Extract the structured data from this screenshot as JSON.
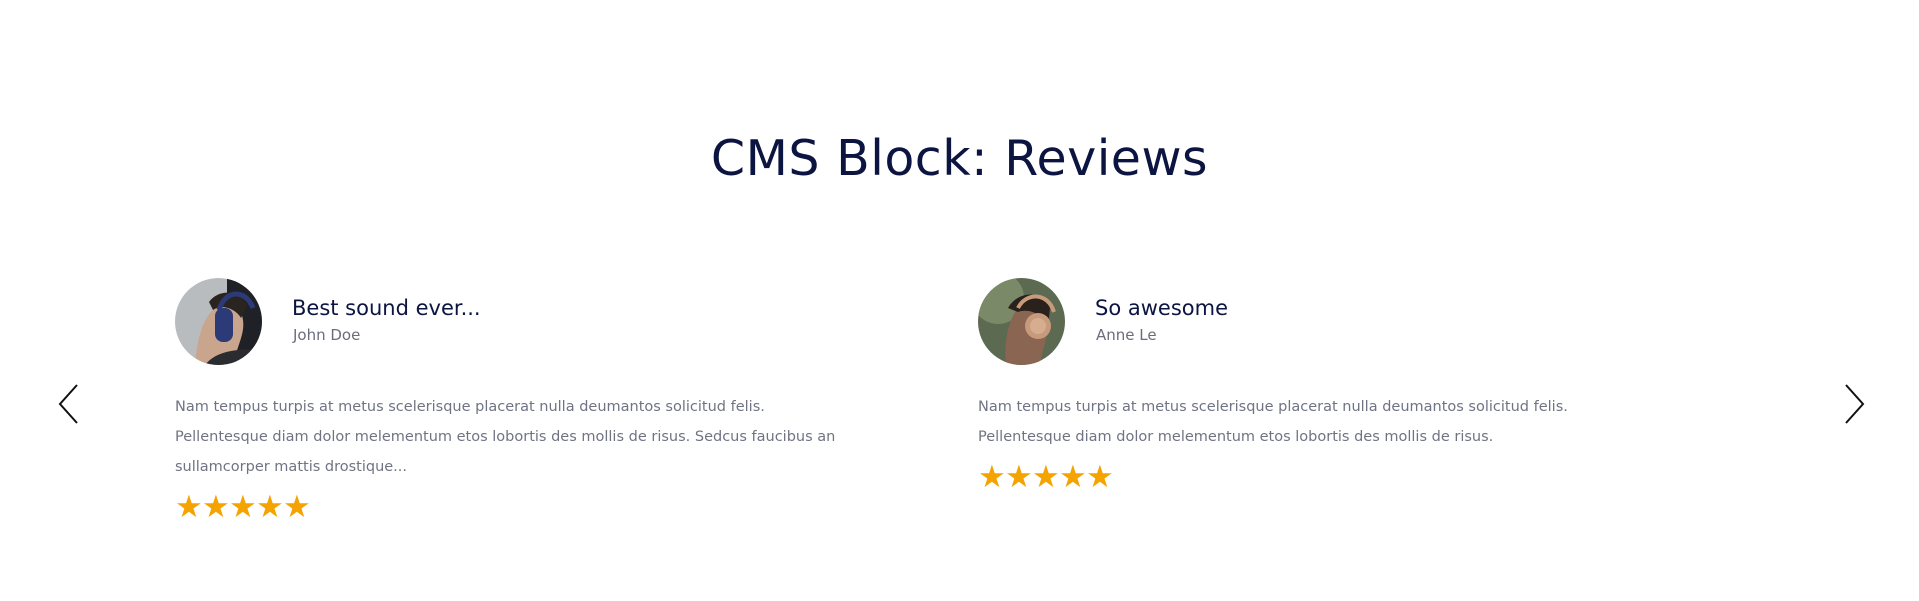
{
  "title": "CMS Block: Reviews",
  "colors": {
    "title": "#0c1441",
    "text": "#707383",
    "star": "#f5a300"
  },
  "nav": {
    "prev_icon": "chevron-left-icon",
    "next_icon": "chevron-right-icon"
  },
  "reviews": [
    {
      "title": "Best sound ever...",
      "author": "John Doe",
      "body": "Nam tempus turpis at metus scelerisque placerat nulla deumantos solicitud felis. Pellentesque diam dolor melementum etos lobortis des mollis de risus. Sedcus faucibus an sullamcorper mattis drostique...",
      "rating": 5,
      "stars": "★★★★★"
    },
    {
      "title": "So awesome",
      "author": "Anne Le",
      "body": "Nam tempus turpis at metus scelerisque placerat nulla deumantos solicitud felis. Pellentesque diam dolor melementum etos lobortis des mollis de risus.",
      "rating": 5,
      "stars": "★★★★★"
    }
  ]
}
